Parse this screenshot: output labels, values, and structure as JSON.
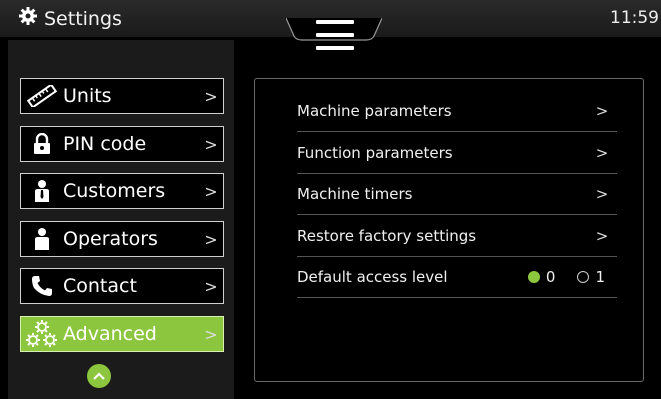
{
  "header": {
    "title": "Settings",
    "time": "11:59"
  },
  "sidebar": {
    "items": [
      {
        "label": "Units",
        "icon": "ruler-icon"
      },
      {
        "label": "PIN code",
        "icon": "lock-icon"
      },
      {
        "label": "Customers",
        "icon": "customer-icon"
      },
      {
        "label": "Operators",
        "icon": "operator-icon"
      },
      {
        "label": "Contact",
        "icon": "phone-icon"
      },
      {
        "label": "Advanced",
        "icon": "gears-icon",
        "active": true
      }
    ]
  },
  "main": {
    "rows": [
      {
        "label": "Machine parameters"
      },
      {
        "label": "Function parameters"
      },
      {
        "label": "Machine timers"
      },
      {
        "label": "Restore factory settings"
      }
    ],
    "access": {
      "label": "Default access level",
      "options": [
        "0",
        "1"
      ],
      "selected": "0"
    }
  },
  "colors": {
    "accent": "#8cc63f",
    "background": "#000000",
    "sidebar": "#1b1b1b"
  }
}
